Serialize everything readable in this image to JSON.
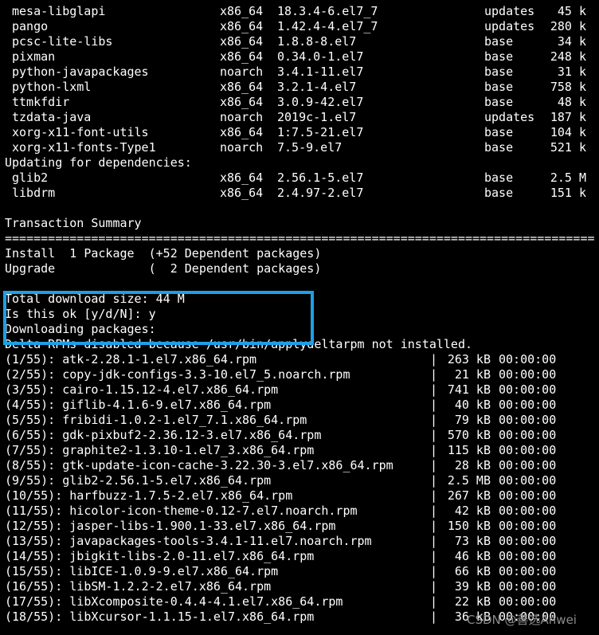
{
  "packages": [
    {
      "name": "mesa-libglapi",
      "arch": "x86_64",
      "version": "18.3.4-6.el7_7",
      "repo": "updates",
      "size": "45 k"
    },
    {
      "name": "pango",
      "arch": "x86_64",
      "version": "1.42.4-4.el7_7",
      "repo": "updates",
      "size": "280 k"
    },
    {
      "name": "pcsc-lite-libs",
      "arch": "x86_64",
      "version": "1.8.8-8.el7",
      "repo": "base",
      "size": "34 k"
    },
    {
      "name": "pixman",
      "arch": "x86_64",
      "version": "0.34.0-1.el7",
      "repo": "base",
      "size": "248 k"
    },
    {
      "name": "python-javapackages",
      "arch": "noarch",
      "version": "3.4.1-11.el7",
      "repo": "base",
      "size": "31 k"
    },
    {
      "name": "python-lxml",
      "arch": "x86_64",
      "version": "3.2.1-4.el7",
      "repo": "base",
      "size": "758 k"
    },
    {
      "name": "ttmkfdir",
      "arch": "x86_64",
      "version": "3.0.9-42.el7",
      "repo": "base",
      "size": "48 k"
    },
    {
      "name": "tzdata-java",
      "arch": "noarch",
      "version": "2019c-1.el7",
      "repo": "updates",
      "size": "187 k"
    },
    {
      "name": "xorg-x11-font-utils",
      "arch": "x86_64",
      "version": "1:7.5-21.el7",
      "repo": "base",
      "size": "104 k"
    },
    {
      "name": "xorg-x11-fonts-Type1",
      "arch": "noarch",
      "version": "7.5-9.el7",
      "repo": "base",
      "size": "521 k"
    }
  ],
  "updating_header": "Updating for dependencies:",
  "updating": [
    {
      "name": "glib2",
      "arch": "x86_64",
      "version": "2.56.1-5.el7",
      "repo": "base",
      "size": "2.5 M"
    },
    {
      "name": "libdrm",
      "arch": "x86_64",
      "version": "2.4.97-2.el7",
      "repo": "base",
      "size": "151 k"
    }
  ],
  "summary_title": "Transaction Summary",
  "separator": "==================================================================================",
  "install_line": "Install  1 Package  (+52 Dependent packages)",
  "upgrade_line": "Upgrade             (  2 Dependent packages)",
  "total_download": "Total download size: 44 M",
  "prompt": "Is this ok [y/d/N]: y",
  "downloading": "Downloading packages:",
  "delta_notice": "Delta RPMs disabled because /usr/bin/applydeltarpm not installed.",
  "downloads": [
    {
      "name": "(1/55): atk-2.28.1-1.el7.x86_64.rpm",
      "size": "263 kB",
      "time": "00:00:00"
    },
    {
      "name": "(2/55): copy-jdk-configs-3.3-10.el7_5.noarch.rpm",
      "size": "21 kB",
      "time": "00:00:00"
    },
    {
      "name": "(3/55): cairo-1.15.12-4.el7.x86_64.rpm",
      "size": "741 kB",
      "time": "00:00:00"
    },
    {
      "name": "(4/55): giflib-4.1.6-9.el7.x86_64.rpm",
      "size": "40 kB",
      "time": "00:00:00"
    },
    {
      "name": "(5/55): fribidi-1.0.2-1.el7_7.1.x86_64.rpm",
      "size": "79 kB",
      "time": "00:00:00"
    },
    {
      "name": "(6/55): gdk-pixbuf2-2.36.12-3.el7.x86_64.rpm",
      "size": "570 kB",
      "time": "00:00:00"
    },
    {
      "name": "(7/55): graphite2-1.3.10-1.el7_3.x86_64.rpm",
      "size": "115 kB",
      "time": "00:00:00"
    },
    {
      "name": "(8/55): gtk-update-icon-cache-3.22.30-3.el7.x86_64.rpm",
      "size": "28 kB",
      "time": "00:00:00"
    },
    {
      "name": "(9/55): glib2-2.56.1-5.el7.x86_64.rpm",
      "size": "2.5 MB",
      "time": "00:00:00"
    },
    {
      "name": "(10/55): harfbuzz-1.7.5-2.el7.x86_64.rpm",
      "size": "267 kB",
      "time": "00:00:00"
    },
    {
      "name": "(11/55): hicolor-icon-theme-0.12-7.el7.noarch.rpm",
      "size": "42 kB",
      "time": "00:00:00"
    },
    {
      "name": "(12/55): jasper-libs-1.900.1-33.el7.x86_64.rpm",
      "size": "150 kB",
      "time": "00:00:00"
    },
    {
      "name": "(13/55): javapackages-tools-3.4.1-11.el7.noarch.rpm",
      "size": "73 kB",
      "time": "00:00:00"
    },
    {
      "name": "(14/55): jbigkit-libs-2.0-11.el7.x86_64.rpm",
      "size": "46 kB",
      "time": "00:00:00"
    },
    {
      "name": "(15/55): libICE-1.0.9-9.el7.x86_64.rpm",
      "size": "66 kB",
      "time": "00:00:00"
    },
    {
      "name": "(16/55): libSM-1.2.2-2.el7.x86_64.rpm",
      "size": "39 kB",
      "time": "00:00:00"
    },
    {
      "name": "(17/55): libXcomposite-0.4.4-4.1.el7.x86_64.rpm",
      "size": "22 kB",
      "time": "00:00:00"
    },
    {
      "name": "(18/55): libXcursor-1.1.15-1.el7.x86_64.rpm",
      "size": "36 kB",
      "time": "00:00:00"
    }
  ],
  "pipe": "|",
  "watermark": "CSDN @善选Anwei",
  "highlight_color": "#1e9fe6"
}
